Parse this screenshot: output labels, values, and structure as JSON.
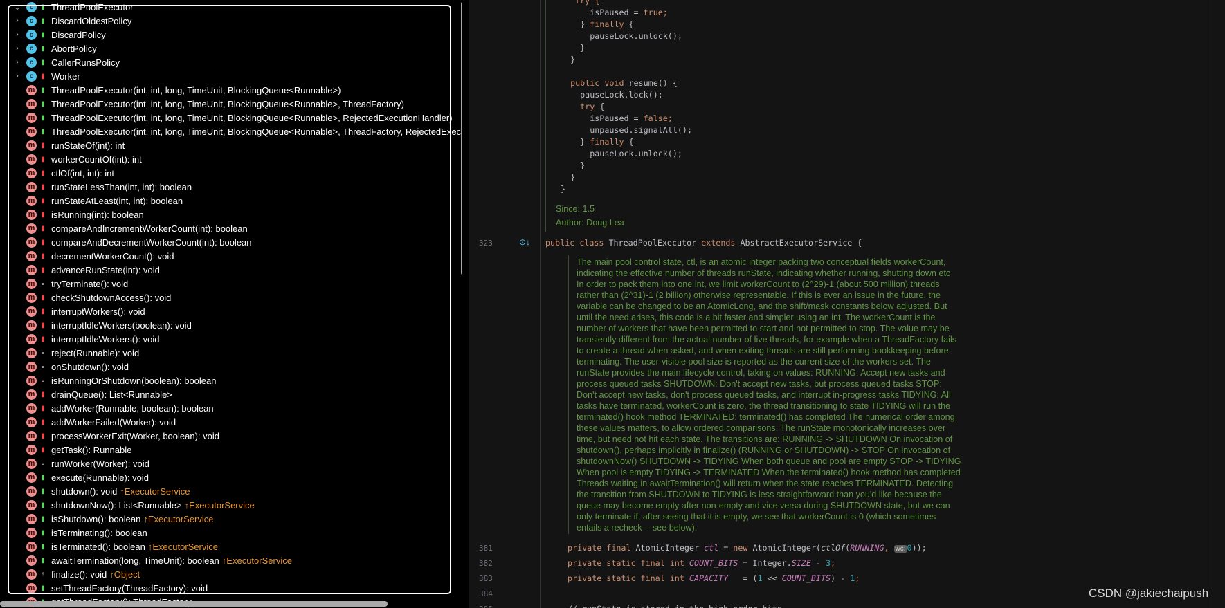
{
  "structure": {
    "items": [
      {
        "kind": "class",
        "vis": "public",
        "label": "ThreadPoolExecutor",
        "expander": "chevron-down"
      },
      {
        "kind": "class",
        "vis": "public",
        "label": "DiscardOldestPolicy",
        "expander": "chevron-right"
      },
      {
        "kind": "class",
        "vis": "public",
        "label": "DiscardPolicy",
        "expander": "chevron-right"
      },
      {
        "kind": "class",
        "vis": "public",
        "label": "AbortPolicy",
        "expander": "chevron-right"
      },
      {
        "kind": "class",
        "vis": "public",
        "label": "CallerRunsPolicy",
        "expander": "chevron-right"
      },
      {
        "kind": "class",
        "vis": "private",
        "label": "Worker",
        "expander": "chevron-right"
      },
      {
        "kind": "method",
        "vis": "public",
        "label": "ThreadPoolExecutor(int, int, long, TimeUnit, BlockingQueue<Runnable>)"
      },
      {
        "kind": "method",
        "vis": "public",
        "label": "ThreadPoolExecutor(int, int, long, TimeUnit, BlockingQueue<Runnable>, ThreadFactory)"
      },
      {
        "kind": "method",
        "vis": "public",
        "label": "ThreadPoolExecutor(int, int, long, TimeUnit, BlockingQueue<Runnable>, RejectedExecutionHandler)"
      },
      {
        "kind": "method",
        "vis": "public",
        "label": "ThreadPoolExecutor(int, int, long, TimeUnit, BlockingQueue<Runnable>, ThreadFactory, RejectedExecutionHandler)"
      },
      {
        "kind": "method",
        "vis": "private",
        "label": "runStateOf(int): int"
      },
      {
        "kind": "method",
        "vis": "private",
        "label": "workerCountOf(int): int"
      },
      {
        "kind": "method",
        "vis": "private",
        "label": "ctlOf(int, int): int"
      },
      {
        "kind": "method",
        "vis": "private",
        "label": "runStateLessThan(int, int): boolean"
      },
      {
        "kind": "method",
        "vis": "private",
        "label": "runStateAtLeast(int, int): boolean"
      },
      {
        "kind": "method",
        "vis": "private",
        "label": "isRunning(int): boolean"
      },
      {
        "kind": "method",
        "vis": "private",
        "label": "compareAndIncrementWorkerCount(int): boolean"
      },
      {
        "kind": "method",
        "vis": "private",
        "label": "compareAndDecrementWorkerCount(int): boolean"
      },
      {
        "kind": "method",
        "vis": "private",
        "label": "decrementWorkerCount(): void"
      },
      {
        "kind": "method",
        "vis": "private",
        "label": "advanceRunState(int): void"
      },
      {
        "kind": "method",
        "vis": "package",
        "label": "tryTerminate(): void"
      },
      {
        "kind": "method",
        "vis": "private",
        "label": "checkShutdownAccess(): void"
      },
      {
        "kind": "method",
        "vis": "private",
        "label": "interruptWorkers(): void"
      },
      {
        "kind": "method",
        "vis": "private",
        "label": "interruptIdleWorkers(boolean): void"
      },
      {
        "kind": "method",
        "vis": "private",
        "label": "interruptIdleWorkers(): void"
      },
      {
        "kind": "method",
        "vis": "package",
        "label": "reject(Runnable): void"
      },
      {
        "kind": "method",
        "vis": "package",
        "label": "onShutdown(): void"
      },
      {
        "kind": "method",
        "vis": "package",
        "label": "isRunningOrShutdown(boolean): boolean"
      },
      {
        "kind": "method",
        "vis": "private",
        "label": "drainQueue(): List<Runnable>"
      },
      {
        "kind": "method",
        "vis": "private",
        "label": "addWorker(Runnable, boolean): boolean"
      },
      {
        "kind": "method",
        "vis": "private",
        "label": "addWorkerFailed(Worker): void"
      },
      {
        "kind": "method",
        "vis": "private",
        "label": "processWorkerExit(Worker, boolean): void"
      },
      {
        "kind": "method",
        "vis": "private",
        "label": "getTask(): Runnable"
      },
      {
        "kind": "method",
        "vis": "package",
        "label": "runWorker(Worker): void"
      },
      {
        "kind": "method",
        "vis": "public",
        "label": "execute(Runnable): void"
      },
      {
        "kind": "method",
        "vis": "public",
        "label": "shutdown(): void",
        "inherited": "↑ExecutorService"
      },
      {
        "kind": "method",
        "vis": "public",
        "label": "shutdownNow(): List<Runnable>",
        "inherited": "↑ExecutorService"
      },
      {
        "kind": "method",
        "vis": "public",
        "label": "isShutdown(): boolean",
        "inherited": "↑ExecutorService"
      },
      {
        "kind": "method",
        "vis": "public",
        "label": "isTerminating(): boolean"
      },
      {
        "kind": "method",
        "vis": "public",
        "label": "isTerminated(): boolean",
        "inherited": "↑ExecutorService"
      },
      {
        "kind": "method",
        "vis": "public",
        "label": "awaitTermination(long, TimeUnit): boolean",
        "inherited": "↑ExecutorService"
      },
      {
        "kind": "method",
        "vis": "protected",
        "label": "finalize(): void",
        "inherited": "↑Object"
      },
      {
        "kind": "method",
        "vis": "public",
        "label": "setThreadFactory(ThreadFactory): void"
      },
      {
        "kind": "method",
        "vis": "public",
        "label": "getThreadFactory(): ThreadFactory"
      }
    ]
  },
  "editor": {
    "doc_code": [
      [
        [
          "   try {",
          "kw"
        ]
      ],
      [
        [
          "      isPaused = ",
          "pl"
        ],
        [
          "true",
          "kw"
        ],
        [
          ";",
          "kw"
        ]
      ],
      [
        [
          "    } ",
          "pl"
        ],
        [
          "finally",
          "kw"
        ],
        [
          " {",
          "pl"
        ]
      ],
      [
        [
          "      pauseLock.unlock();",
          "pl"
        ]
      ],
      [
        [
          "    }",
          "pl"
        ]
      ],
      [
        [
          "  }",
          "pl"
        ]
      ],
      [
        [
          "",
          "pl"
        ]
      ],
      [
        [
          "  ",
          "pl"
        ],
        [
          "public void",
          "kw"
        ],
        [
          " resume() {",
          "pl"
        ]
      ],
      [
        [
          "    pauseLock.lock();",
          "pl"
        ]
      ],
      [
        [
          "    ",
          "pl"
        ],
        [
          "try",
          "kw"
        ],
        [
          " {",
          "pl"
        ]
      ],
      [
        [
          "      isPaused = ",
          "pl"
        ],
        [
          "false",
          "kw"
        ],
        [
          ";",
          "kw"
        ]
      ],
      [
        [
          "      unpaused.signalAll();",
          "pl"
        ]
      ],
      [
        [
          "    } ",
          "pl"
        ],
        [
          "finally",
          "kw"
        ],
        [
          " {",
          "pl"
        ]
      ],
      [
        [
          "      pauseLock.unlock();",
          "pl"
        ]
      ],
      [
        [
          "    }",
          "pl"
        ]
      ],
      [
        [
          "  }",
          "pl"
        ]
      ],
      [
        [
          "}",
          "pl"
        ]
      ]
    ],
    "since_label": "Since:   1.5",
    "author_label": "Author: Doug Lea",
    "class_line": {
      "number": "323",
      "tokens": [
        [
          "public class ",
          "kw"
        ],
        [
          "ThreadPoolExecutor ",
          "pl"
        ],
        [
          "extends ",
          "kw"
        ],
        [
          "AbstractExecutorService {",
          "pl"
        ]
      ]
    },
    "javadoc": [
      "The main pool control state, ctl, is an atomic integer packing two conceptual fields workerCount,",
      "indicating the effective number of threads runState, indicating whether running, shutting down etc",
      "In order to pack them into one int, we limit workerCount to (2^29)-1 (about 500 million) threads",
      "rather than (2^31)-1 (2 billion) otherwise representable. If this is ever an issue in the future, the",
      "variable can be changed to be an AtomicLong, and the shift/mask constants below adjusted. But",
      "until the need arises, this code is a bit faster and simpler using an int. The workerCount is the",
      "number of workers that have been permitted to start and not permitted to stop. The value may be",
      "transiently different from the actual number of live threads, for example when a ThreadFactory fails",
      "to create a thread when asked, and when exiting threads are still performing bookkeeping before",
      "terminating. The user-visible pool size is reported as the current size of the workers set. The",
      "runState provides the main lifecycle control, taking on values: RUNNING: Accept new tasks and",
      "process queued tasks SHUTDOWN: Don't accept new tasks, but process queued tasks STOP:",
      "Don't accept new tasks, don't process queued tasks, and interrupt in-progress tasks TIDYING: All",
      "tasks have terminated, workerCount is zero, the thread transitioning to state TIDYING will run the",
      "terminated() hook method TERMINATED: terminated() has completed The numerical order among",
      "these values matters, to allow ordered comparisons. The runState monotonically increases over",
      "time, but need not hit each state. The transitions are: RUNNING -> SHUTDOWN On invocation of",
      "shutdown(), perhaps implicitly in finalize() (RUNNING or SHUTDOWN) -> STOP On invocation of",
      "shutdownNow() SHUTDOWN -> TIDYING When both queue and pool are empty STOP -> TIDYING",
      "When pool is empty TIDYING -> TERMINATED When the terminated() hook method has completed",
      "Threads waiting in awaitTermination() will return when the state reaches TERMINATED. Detecting",
      "the transition from SHUTDOWN to TIDYING is less straightforward than you'd like because the",
      "queue may become empty after non-empty and vice versa during SHUTDOWN state, but we can",
      "only terminate if, after seeing that it is empty, we see that workerCount is 0 (which sometimes",
      "entails a recheck -- see below)."
    ],
    "lines": [
      {
        "number": "381",
        "tokens": [
          [
            "private final ",
            "kw"
          ],
          [
            "AtomicInteger ",
            "pl"
          ],
          [
            "ctl",
            "cn"
          ],
          [
            " = ",
            "pl"
          ],
          [
            "new ",
            "kw"
          ],
          [
            "AtomicInteger(",
            "pl"
          ],
          [
            "ctlOf",
            "it"
          ],
          [
            "(",
            "pl"
          ],
          [
            "RUNNING",
            "cn"
          ],
          [
            ", ",
            "kw"
          ],
          [
            "wc:",
            "hint"
          ],
          [
            "0",
            "num"
          ],
          [
            "));",
            "pl"
          ]
        ]
      },
      {
        "number": "382",
        "tokens": [
          [
            "private static final int ",
            "kw"
          ],
          [
            "COUNT_BITS",
            "cn"
          ],
          [
            " = Integer.",
            "pl"
          ],
          [
            "SIZE",
            "cn"
          ],
          [
            " - ",
            "pl"
          ],
          [
            "3",
            "num"
          ],
          [
            ";",
            "kw"
          ]
        ]
      },
      {
        "number": "383",
        "tokens": [
          [
            "private static final int ",
            "kw"
          ],
          [
            "CAPACITY",
            "cn"
          ],
          [
            "   = (",
            "pl"
          ],
          [
            "1",
            "num"
          ],
          [
            " << ",
            "pl"
          ],
          [
            "COUNT_BITS",
            "cn"
          ],
          [
            ") - ",
            "pl"
          ],
          [
            "1",
            "num"
          ],
          [
            ";",
            "kw"
          ]
        ]
      },
      {
        "number": "384",
        "tokens": []
      },
      {
        "number": "385",
        "tokens": [
          [
            "// runState is stored in the high-order bits",
            "pl"
          ]
        ]
      }
    ]
  },
  "watermark": "CSDN @jakiechaipush",
  "colors": {
    "keyword": "#cf8e6d",
    "constant": "#c77dbb",
    "number": "#2aacb8",
    "doc": "#5f9440",
    "inherited": "#e8952e",
    "method_icon": "#ef8f8f",
    "class_icon": "#4fc3e8"
  }
}
